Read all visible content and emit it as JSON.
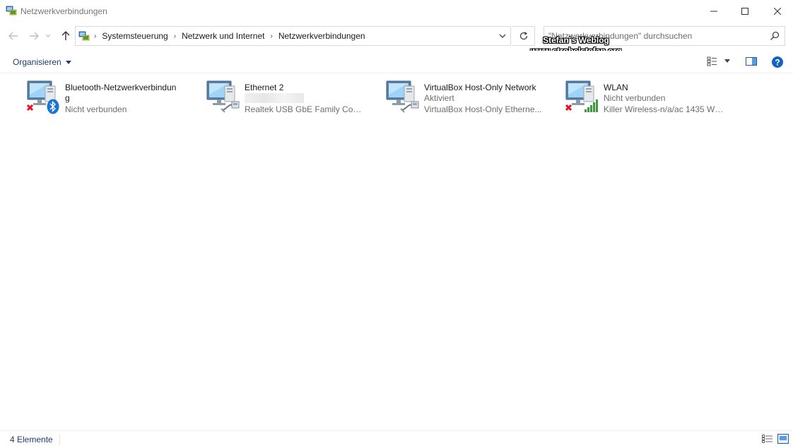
{
  "window": {
    "title": "Netzwerkverbindungen",
    "minimize_icon": "minimize-icon",
    "maximize_icon": "maximize-icon",
    "close_icon": "close-icon"
  },
  "address": {
    "crumbs": [
      "Systemsteuerung",
      "Netzwerk und Internet",
      "Netzwerkverbindungen"
    ],
    "search_placeholder": "\"Netzwerkverbindungen\" durchsuchen"
  },
  "watermark": {
    "line1": "Stefan´s Weblog",
    "line2": "www.strobelstefan.org"
  },
  "toolbar": {
    "organize_label": "Organisieren"
  },
  "connections": [
    {
      "name": "Bluetooth-Netzwerkverbindung",
      "status": "Nicht verbunden",
      "device": "",
      "badge": "bluetooth-icon",
      "disconnected": true
    },
    {
      "name": "Ethernet 2",
      "status": "",
      "device": "Realtek USB GbE Family Contr...",
      "badge": "ethernet-cable-icon",
      "disconnected": false
    },
    {
      "name": "VirtualBox Host-Only Network",
      "status": "Aktiviert",
      "device": "VirtualBox Host-Only Etherne...",
      "badge": "ethernet-cable-icon",
      "disconnected": false
    },
    {
      "name": "WLAN",
      "status": "Nicht verbunden",
      "device": "Killer Wireless-n/a/ac 1435 Wi...",
      "badge": "wifi-signal-icon",
      "disconnected": true
    }
  ],
  "status_bar": {
    "count": "4 Elemente"
  },
  "colors": {
    "link_blue": "#1e3c6c",
    "error_red": "#e81123",
    "signal_green": "#3c9b3c",
    "bluetooth_blue": "#1b74d2"
  }
}
